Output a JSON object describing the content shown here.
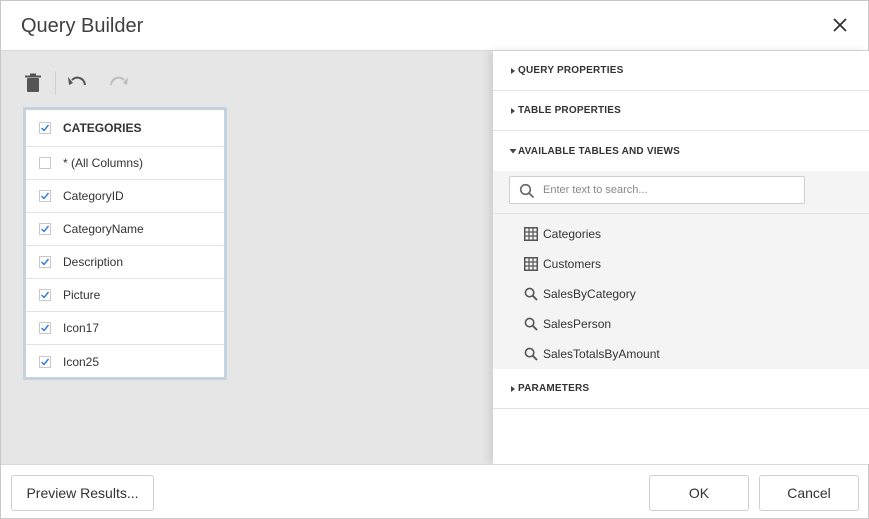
{
  "dialog": {
    "title": "Query Builder"
  },
  "table_card": {
    "name": "CATEGORIES",
    "columns": [
      {
        "label": "* (All Columns)",
        "checked": false
      },
      {
        "label": "CategoryID",
        "checked": true
      },
      {
        "label": "CategoryName",
        "checked": true
      },
      {
        "label": "Description",
        "checked": true
      },
      {
        "label": "Picture",
        "checked": true
      },
      {
        "label": "Icon17",
        "checked": true
      },
      {
        "label": "Icon25",
        "checked": true
      }
    ]
  },
  "panel": {
    "sections": {
      "query_properties": "QUERY PROPERTIES",
      "table_properties": "TABLE PROPERTIES",
      "available_tables": "AVAILABLE TABLES AND VIEWS",
      "parameters": "PARAMETERS"
    },
    "search": {
      "placeholder": "Enter text to search...",
      "value": ""
    },
    "tables": [
      {
        "label": "Categories",
        "kind": "table"
      },
      {
        "label": "Customers",
        "kind": "table"
      },
      {
        "label": "SalesByCategory",
        "kind": "view"
      },
      {
        "label": "SalesPerson",
        "kind": "view"
      },
      {
        "label": "SalesTotalsByAmount",
        "kind": "view"
      }
    ]
  },
  "footer": {
    "preview_label": "Preview Results...",
    "ok_label": "OK",
    "cancel_label": "Cancel"
  },
  "colors": {
    "surface": "#e6e6e6",
    "card_border": "#c5d3e0",
    "list_bg": "#f4f4f4"
  },
  "icons": {
    "close": "close-icon",
    "delete": "trash-icon",
    "undo": "undo-icon",
    "redo": "redo-icon",
    "search": "search-icon",
    "table": "table-grid-icon",
    "view": "view-search-icon"
  }
}
